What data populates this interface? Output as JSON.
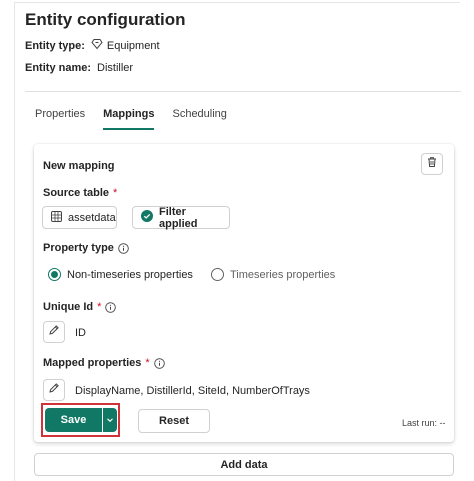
{
  "header": {
    "title": "Entity configuration",
    "entity_type_label": "Entity type:",
    "entity_type_value": "Equipment",
    "entity_name_label": "Entity name:",
    "entity_name_value": "Distiller"
  },
  "tabs": [
    {
      "label": "Properties",
      "active": false
    },
    {
      "label": "Mappings",
      "active": true
    },
    {
      "label": "Scheduling",
      "active": false
    }
  ],
  "mapping": {
    "title": "New mapping",
    "source_table_label": "Source table",
    "required_mark": "*",
    "source_table_value": "assetdata",
    "filter_label": "Filter applied",
    "property_type_label": "Property type",
    "options": [
      {
        "label": "Non-timeseries properties",
        "selected": true
      },
      {
        "label": "Timeseries properties",
        "selected": false
      }
    ],
    "unique_id_label": "Unique Id",
    "unique_id_value": "ID",
    "mapped_properties_label": "Mapped properties",
    "mapped_properties_value": "DisplayName, DistillerId, SiteId, NumberOfTrays",
    "save_label": "Save",
    "reset_label": "Reset",
    "last_run": "Last run: --"
  },
  "add_data_label": "Add data",
  "colors": {
    "accent": "#117865",
    "highlight": "#d13438",
    "required": "#c50f1f"
  }
}
